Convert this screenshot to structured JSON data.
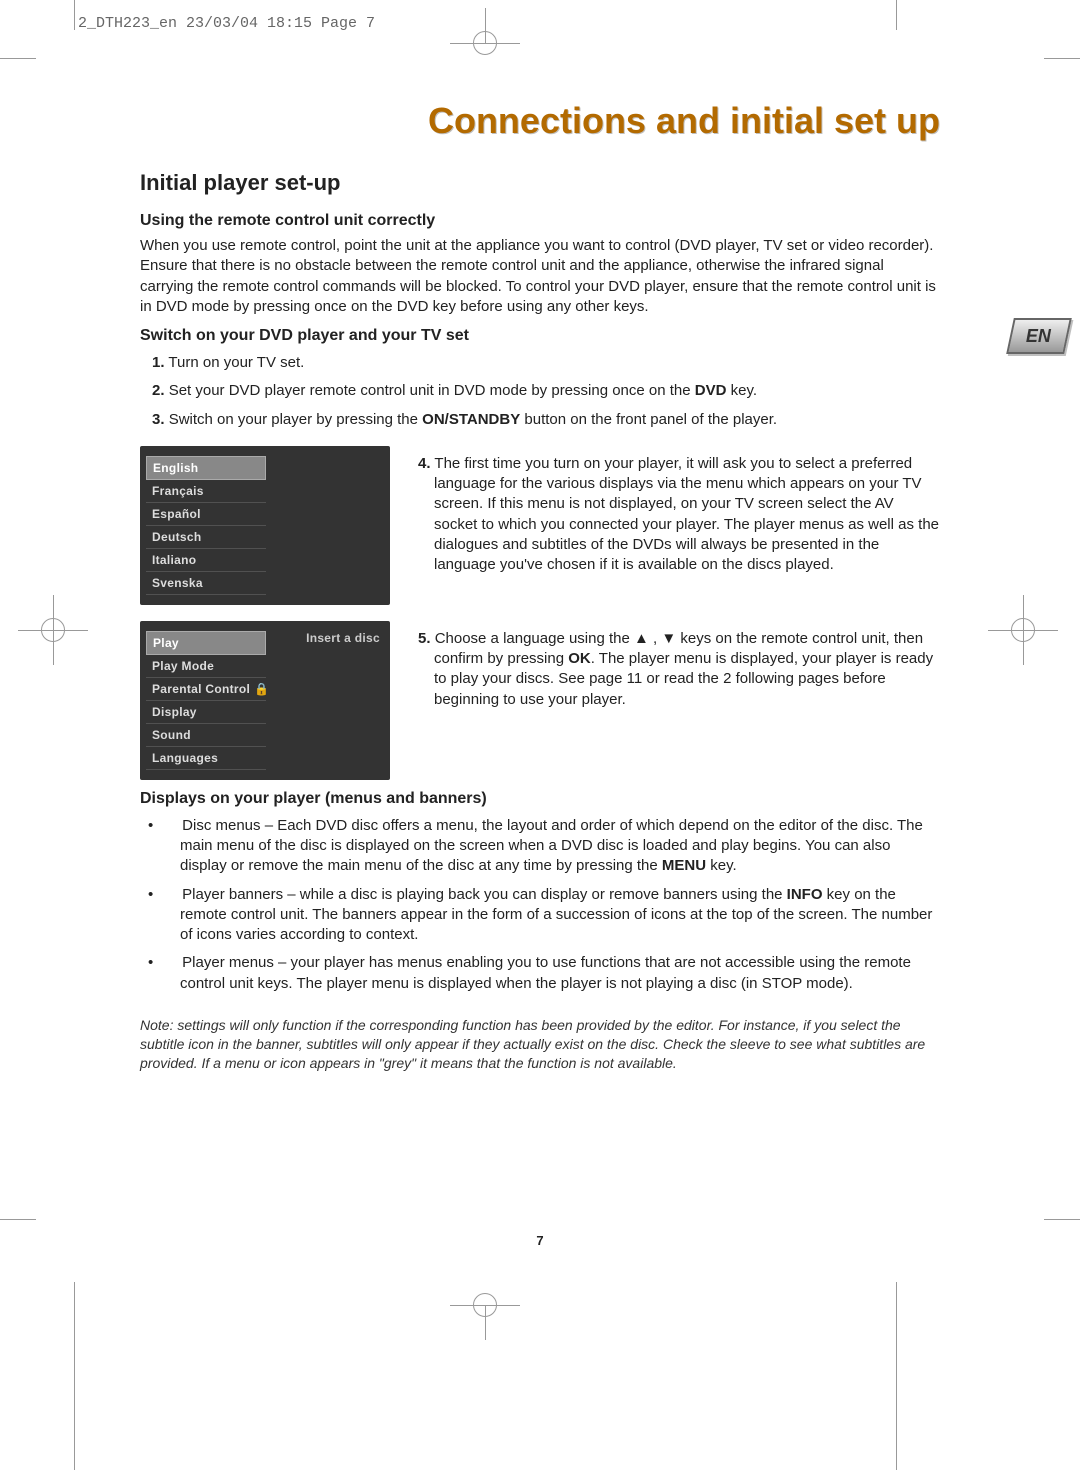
{
  "crop_header": "2_DTH223_en  23/03/04  18:15  Page 7",
  "page_number": "7",
  "lang_badge": "EN",
  "title": "Connections and initial set up",
  "h1": "Initial player set-up",
  "section1": {
    "heading": "Using the remote control unit correctly",
    "body": "When you use remote control, point the unit at the appliance you want to control (DVD player, TV set or video recorder). Ensure that there is no obstacle between the remote control unit and the appliance, otherwise the infrared signal carrying the remote control commands will be blocked. To control your DVD player, ensure that the remote control unit is in DVD mode by pressing once on the DVD key before using any other keys."
  },
  "section2": {
    "heading": "Switch on your DVD player and your TV set",
    "steps": [
      {
        "num": "1.",
        "text_before": "Turn on your TV set.",
        "bold": "",
        "text_after": ""
      },
      {
        "num": "2.",
        "text_before": "Set your DVD player remote control unit in DVD mode by pressing once on the ",
        "bold": "DVD",
        "text_after": " key."
      },
      {
        "num": "3.",
        "text_before": "Switch on your player by pressing the ",
        "bold": "ON/STANDBY",
        "text_after": " button on the front panel of the player."
      }
    ],
    "step4": {
      "num": "4.",
      "text": "The first time you turn on your player, it will ask you to select a preferred language for the various displays via the menu which appears on your TV screen. If this menu is not displayed, on your TV screen select the AV socket to which you connected your player. The player menus as well as the dialogues and subtitles of the DVDs will always be presented in the language you've chosen if it is available on the discs played."
    },
    "step5": {
      "num": "5.",
      "text_a": "Choose a language using the ",
      "arrow_up": "▲",
      "sep": " , ",
      "arrow_down": "▼",
      "text_b": " keys on the remote control unit, then confirm by pressing ",
      "bold": "OK",
      "text_c": ". The player menu is displayed, your player is ready to play your discs. See page 11 or read the 2 following pages before beginning to use your player."
    }
  },
  "menu_lang": {
    "items": [
      "English",
      "Français",
      "Español",
      "Deutsch",
      "Italiano",
      "Svenska"
    ],
    "selected_index": 0
  },
  "menu_player": {
    "items": [
      "Play",
      "Play Mode",
      "Parental Control",
      "Display",
      "Sound",
      "Languages"
    ],
    "selected_index": 0,
    "right_note": "Insert a disc",
    "lock_icon": "🔒"
  },
  "section3": {
    "heading": "Displays on your player (menus and banners)",
    "bullets": [
      {
        "pre": "Disc menus – Each DVD disc offers a menu, the layout and order of which depend on the editor of the disc. The main menu of the disc is displayed on the screen when a DVD disc is loaded and play begins. You can also display or remove the main menu of the disc at any time by pressing the ",
        "bold": "MENU",
        "post": " key."
      },
      {
        "pre": "Player banners – while a disc is playing back you can display or remove banners using the ",
        "bold": "INFO",
        "post": " key on the remote control unit. The banners appear in the form of a succession of icons at the top of the screen. The number of icons varies according to context."
      },
      {
        "pre": "Player menus – your player has menus enabling you to use functions that are not accessible using the remote control unit keys. The player menu is displayed when the player is not playing a disc (in STOP mode).",
        "bold": "",
        "post": ""
      }
    ]
  },
  "note": "Note: settings will only function if the corresponding function has been provided by the editor. For instance, if you select the subtitle icon in the banner, subtitles will only appear if they actually exist on the disc. Check the sleeve to see what subtitles are provided. If a menu or icon appears in \"grey\" it means that the function is not available."
}
